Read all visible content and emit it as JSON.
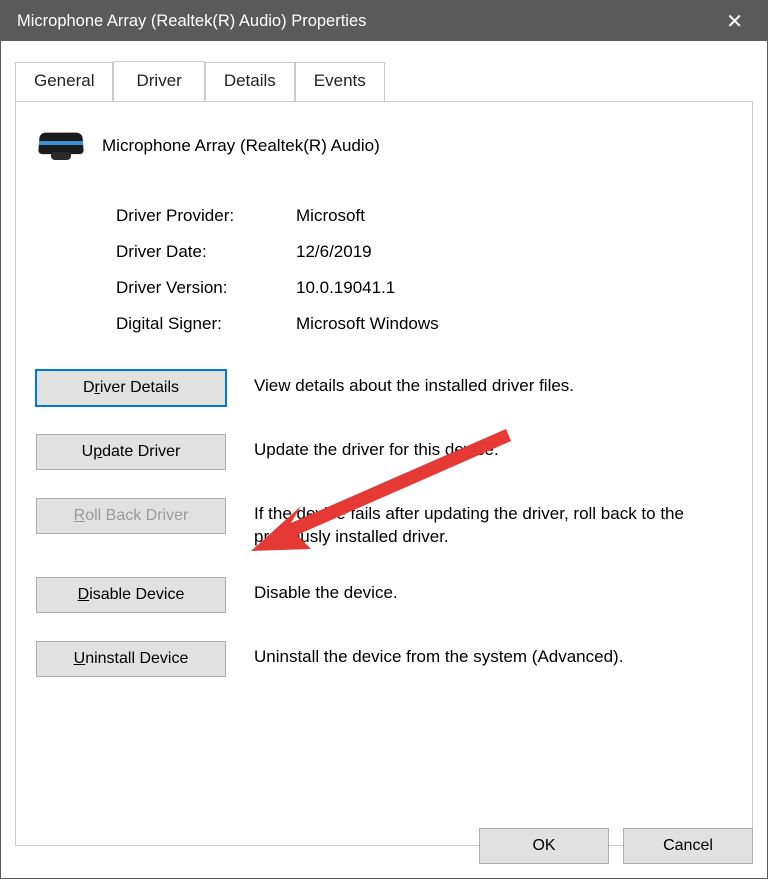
{
  "window": {
    "title": "Microphone Array (Realtek(R) Audio) Properties"
  },
  "tabs": [
    {
      "id": "general",
      "label": "General",
      "active": false
    },
    {
      "id": "driver",
      "label": "Driver",
      "active": true
    },
    {
      "id": "details",
      "label": "Details",
      "active": false
    },
    {
      "id": "events",
      "label": "Events",
      "active": false
    }
  ],
  "device": {
    "icon": "webcam-icon",
    "name": "Microphone Array (Realtek(R) Audio)"
  },
  "driverInfo": {
    "providerLabel": "Driver Provider:",
    "providerValue": "Microsoft",
    "dateLabel": "Driver Date:",
    "dateValue": "12/6/2019",
    "versionLabel": "Driver Version:",
    "versionValue": "10.0.19041.1",
    "signerLabel": "Digital Signer:",
    "signerValue": "Microsoft Windows"
  },
  "actions": {
    "details": {
      "label": "Driver Details",
      "mnemonic": "r",
      "desc": "View details about the installed driver files.",
      "enabled": true,
      "focused": true
    },
    "update": {
      "label": "Update Driver",
      "mnemonic": "p",
      "desc": "Update the driver for this device.",
      "enabled": true,
      "focused": false
    },
    "rollback": {
      "label": "Roll Back Driver",
      "mnemonic": "R",
      "desc": "If the device fails after updating the driver, roll back to the previously installed driver.",
      "enabled": false,
      "focused": false
    },
    "disable": {
      "label": "Disable Device",
      "mnemonic": "D",
      "desc": "Disable the device.",
      "enabled": true,
      "focused": false
    },
    "uninstall": {
      "label": "Uninstall Device",
      "mnemonic": "U",
      "desc": "Uninstall the device from the system (Advanced).",
      "enabled": true,
      "focused": false
    }
  },
  "footer": {
    "ok": "OK",
    "cancel": "Cancel"
  },
  "annotation": {
    "arrowColor": "#e53935"
  }
}
